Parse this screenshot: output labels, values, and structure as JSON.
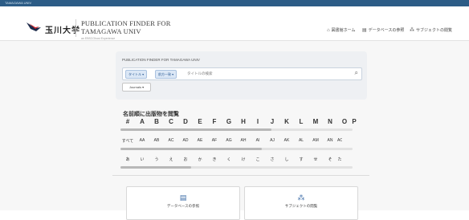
{
  "topbar": {
    "label": "TAMAGAWA UNIV"
  },
  "header": {
    "logo_text": "玉川大学",
    "title_line1": "PUBLICATION FINDER FOR",
    "title_line2": "TAMAGAWA UNIV",
    "subtitle": "an EBSCOhost Experience",
    "nav": [
      {
        "icon": "home-icon",
        "glyph": "⌂",
        "label": "図書館ホーム"
      },
      {
        "icon": "database-icon",
        "glyph": "▤",
        "label": "データベースの参照"
      },
      {
        "icon": "subject-icon",
        "glyph": "⁂",
        "label": "サブジェクトの閲覧"
      }
    ]
  },
  "search": {
    "label": "PUBLICATION FINDER FOR TAMAGAWA UNIV",
    "field_select": "タイトル",
    "match_select": "前方一致",
    "placeholder": "タイトルの検索",
    "toggle_label": "Journals"
  },
  "browse": {
    "title": "名前順に出版物を閲覧",
    "letters": [
      "#",
      "A",
      "B",
      "C",
      "D",
      "E",
      "F",
      "G",
      "H",
      "I",
      "J",
      "K",
      "L",
      "M",
      "N",
      "O",
      "P"
    ],
    "latin_groups": [
      "すべて",
      "AA",
      "AB",
      "AC",
      "AD",
      "AE",
      "AF",
      "AG",
      "AH",
      "AI",
      "AJ",
      "AK",
      "AL",
      "AM",
      "AN",
      "AO"
    ],
    "kana": [
      "あ",
      "い",
      "う",
      "え",
      "お",
      "か",
      "き",
      "く",
      "け",
      "こ",
      "さ",
      "し",
      "す",
      "せ",
      "そ",
      "た"
    ]
  },
  "cards": [
    {
      "icon": "database-icon",
      "glyph": "▤",
      "label": "データベースの参照"
    },
    {
      "icon": "subject-icon",
      "glyph": "⁂",
      "label": "サブジェクトの閲覧"
    }
  ],
  "colors": {
    "topbar": "#2c5c86",
    "accent": "#3a6aa6",
    "panel": "#eef0f3"
  }
}
